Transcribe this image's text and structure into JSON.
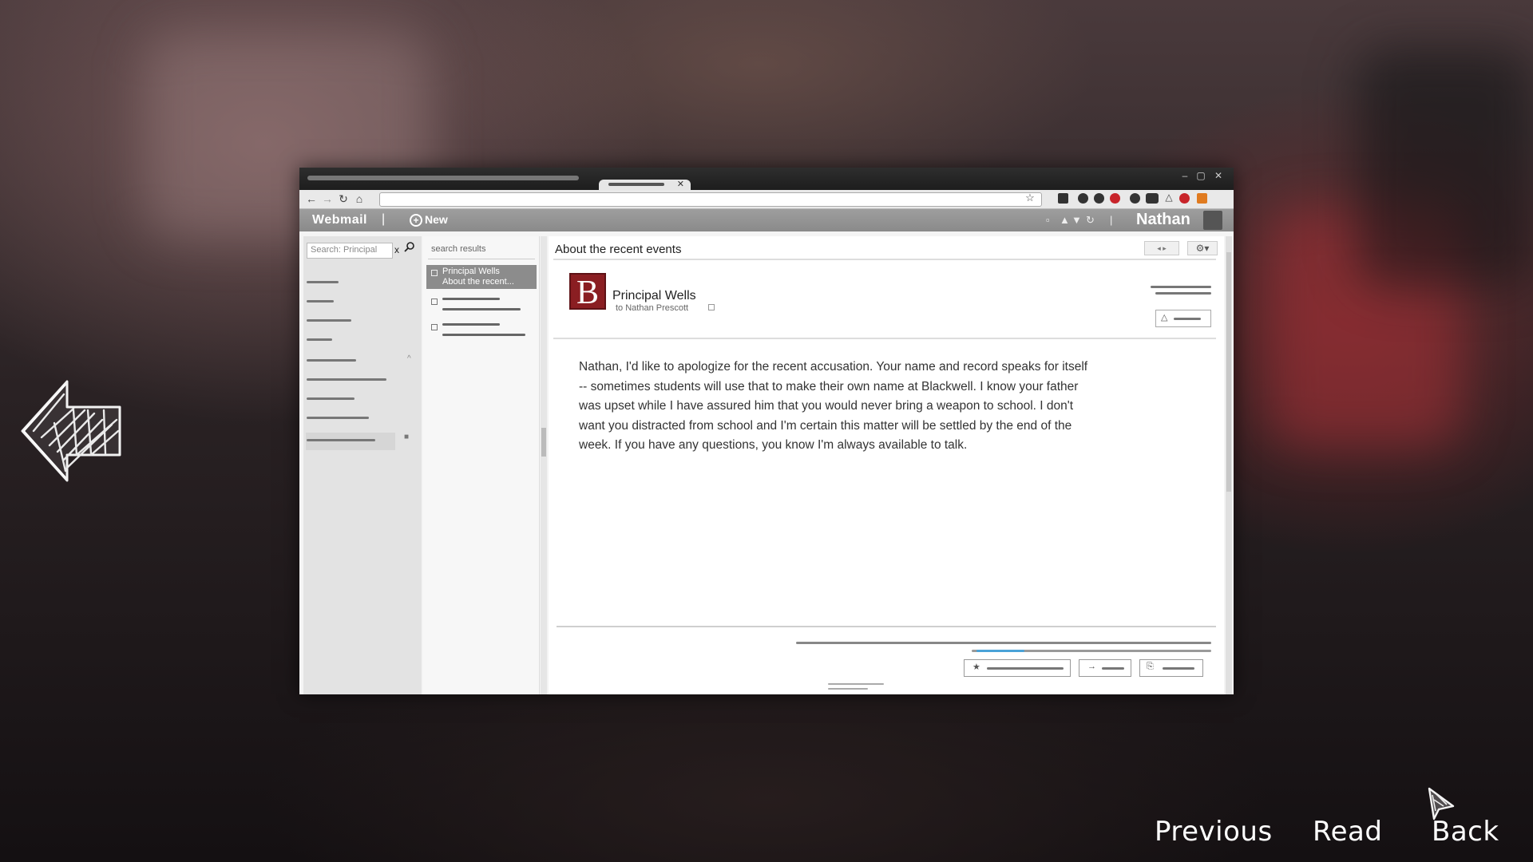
{
  "browser": {
    "window_controls": [
      "–",
      "▢",
      "✕"
    ],
    "nav_icons": [
      "back-arrow-icon",
      "forward-arrow-icon",
      "reload-icon",
      "home-icon"
    ]
  },
  "webmail": {
    "brand": "Webmail",
    "separator": "|",
    "new_label": "New",
    "user_name": "Nathan"
  },
  "sidebar": {
    "search_placeholder": "Search: Principal",
    "clear_symbol": "x"
  },
  "message_list": {
    "header": "search results",
    "selected_from": "Principal Wells",
    "selected_subject": "About the recent..."
  },
  "email": {
    "subject": "About the recent events",
    "logo_letter": "B",
    "sender": "Principal Wells",
    "recipient": "to Nathan Prescott",
    "body": "Nathan, I'd like to apologize for the recent accusation. Your name and record speaks for itself -- sometimes students will use that to make their own name at Blackwell. I know your father was upset while I have assured him that you would never bring a weapon to school. I don't want you distracted from school and I'm certain this matter will be settled by the end of the week. If you have any questions, you know I'm always available to talk."
  },
  "game_nav": {
    "previous": "Previous",
    "read": "Read",
    "back": "Back"
  },
  "colors": {
    "logo": "#8a1e22",
    "mail_bar": "#959595",
    "ext_red": "#c8242a",
    "ext_orange": "#e07b20"
  }
}
